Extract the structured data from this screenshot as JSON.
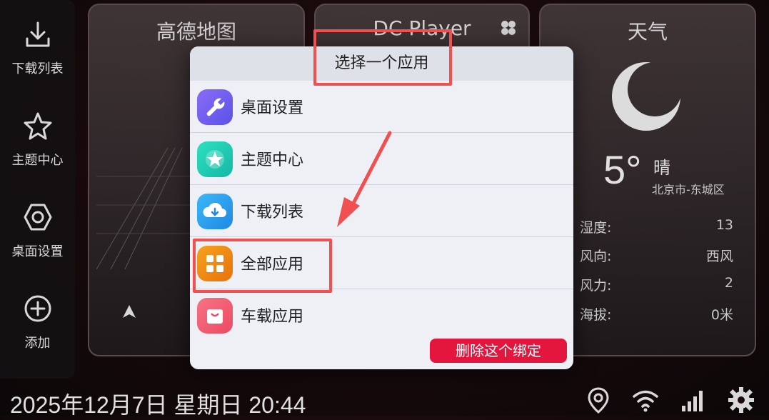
{
  "sidebar": {
    "items": [
      {
        "label": "下载列表",
        "icon": "download-icon"
      },
      {
        "label": "主题中心",
        "icon": "star-icon"
      },
      {
        "label": "桌面设置",
        "icon": "hexagon-settings-icon"
      },
      {
        "label": "添加",
        "icon": "add-circle-icon"
      }
    ]
  },
  "cards": {
    "map_title": "高德地图",
    "player_title": "DC Player",
    "weather_title": "天气"
  },
  "weather": {
    "temp": "5°",
    "condition": "晴",
    "location": "北京市-东城区",
    "rows": [
      {
        "label": "湿度:",
        "value": "13"
      },
      {
        "label": "风向:",
        "value": "西风"
      },
      {
        "label": "风力:",
        "value": "2"
      },
      {
        "label": "海拔:",
        "value": "0米"
      }
    ]
  },
  "dialog": {
    "title": "选择一个应用",
    "apps": [
      {
        "name": "桌面设置",
        "icon": "wrench-icon",
        "color": "#6a5cf0"
      },
      {
        "name": "主题中心",
        "icon": "star-icon",
        "color": "#1fd1b4"
      },
      {
        "name": "下载列表",
        "icon": "cloud-download-icon",
        "color": "#2aa6f0"
      },
      {
        "name": "全部应用",
        "icon": "grid-icon",
        "color": "#f08a16"
      },
      {
        "name": "车载应用",
        "icon": "shopping-bag-icon",
        "color": "#f0566a"
      }
    ],
    "delete_label": "删除这个绑定"
  },
  "status": {
    "datetime": "2025年12月7日 星期日 20:44"
  },
  "colors": {
    "highlight": "#f0504f",
    "delete_button": "#e4163e"
  }
}
